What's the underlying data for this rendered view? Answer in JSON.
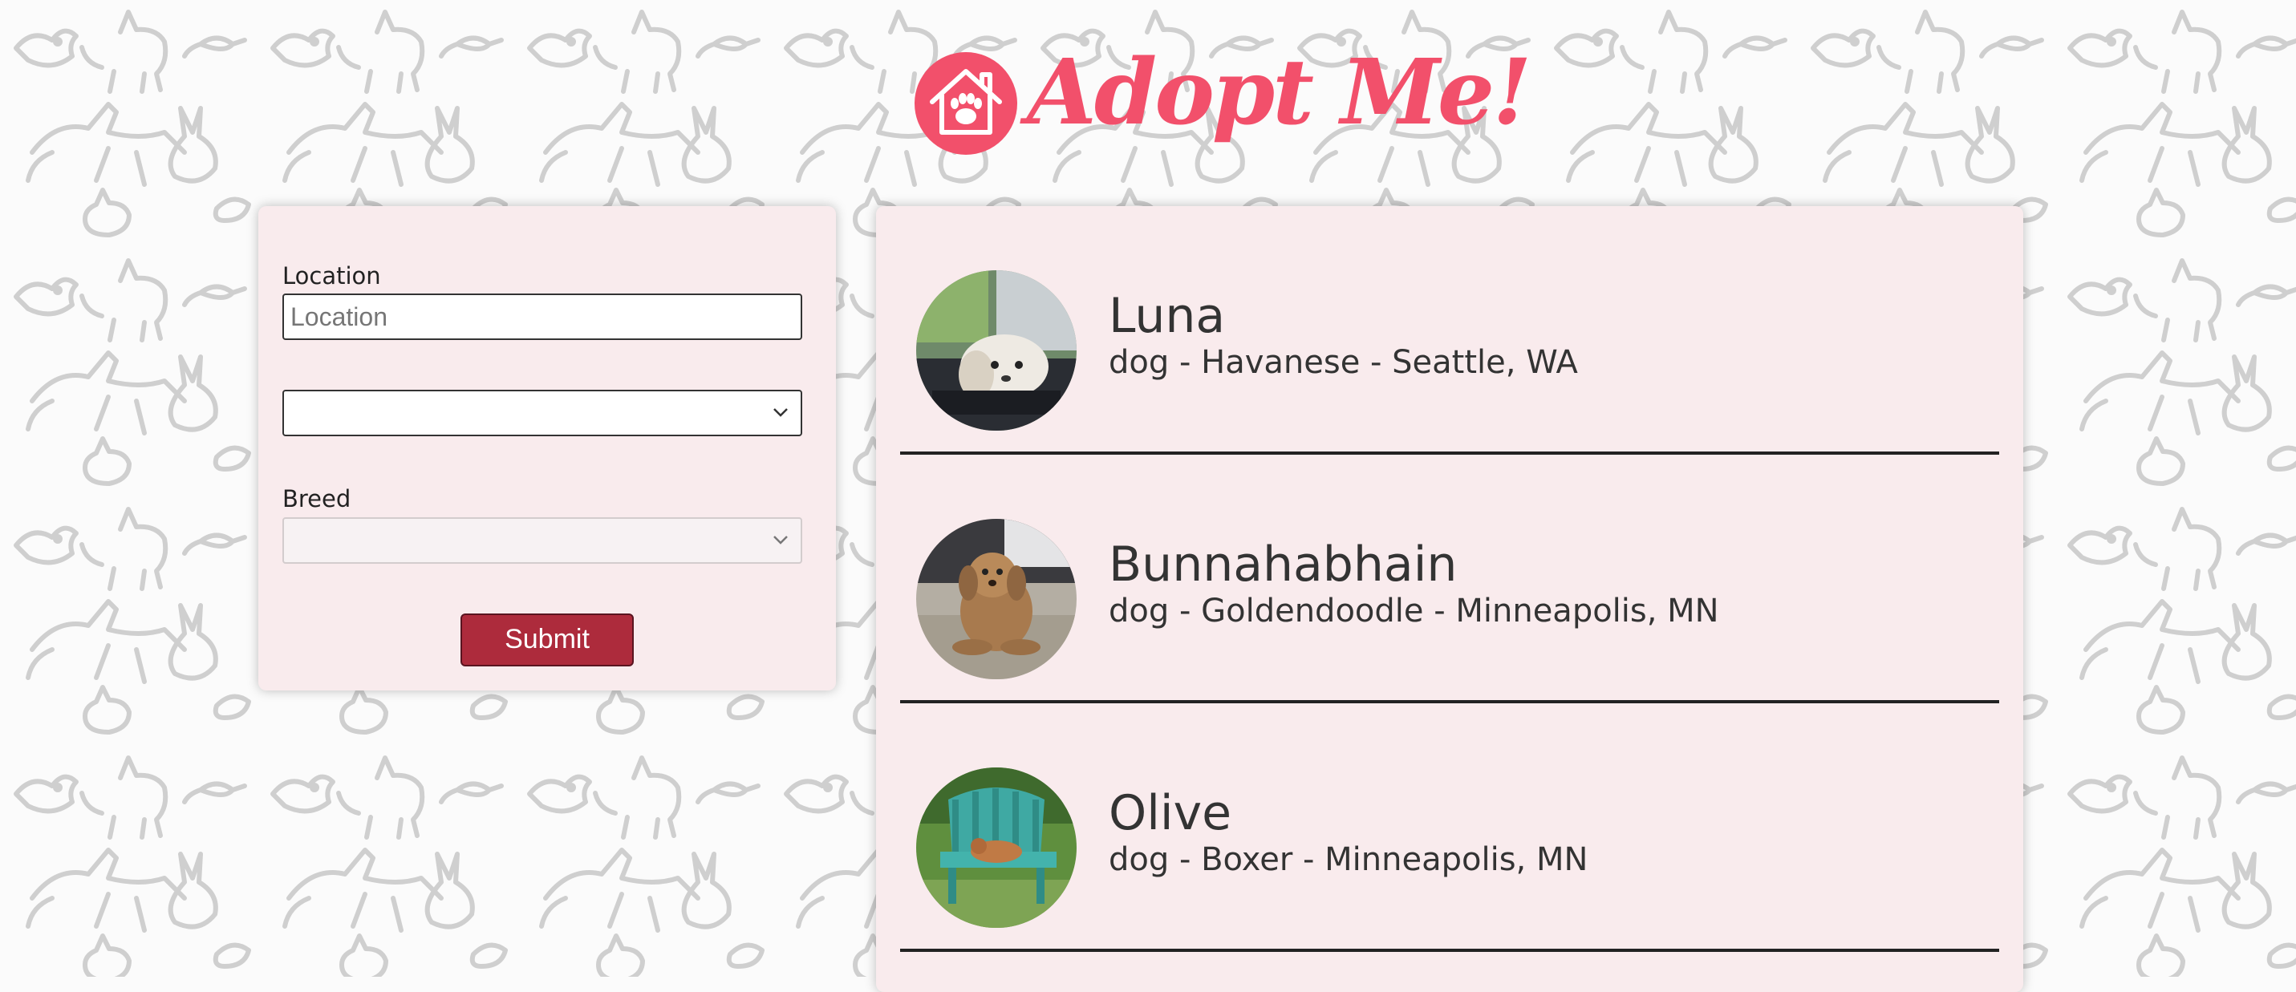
{
  "header": {
    "logo_text": "Adopt Me!",
    "brand_color": "#f2506b"
  },
  "search": {
    "location_label": "Location",
    "location_placeholder": "Location",
    "location_value": "",
    "animal_value": "",
    "breed_label": "Breed",
    "breed_value": "",
    "submit_label": "Submit",
    "submit_color": "#ad2b3c"
  },
  "pets": [
    {
      "name": "Luna",
      "details": "dog - Havanese - Seattle, WA"
    },
    {
      "name": "Bunnahabhain",
      "details": "dog - Goldendoodle - Minneapolis, MN"
    },
    {
      "name": "Olive",
      "details": "dog - Boxer - Minneapolis, MN"
    }
  ],
  "colors": {
    "panel_background": "#f9ebed",
    "page_background": "#fbfbfb",
    "pattern": "#cfcfcf"
  }
}
